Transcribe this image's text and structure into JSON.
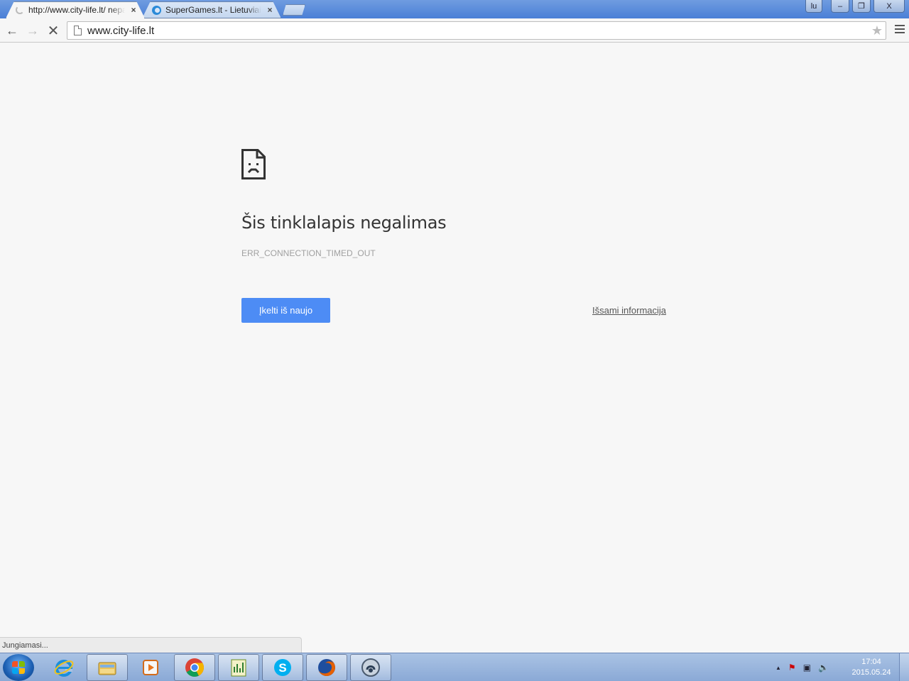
{
  "browser": {
    "tabs": [
      {
        "title": "http://www.city-life.lt/ nepasiekiamas",
        "icon": "loading-spinner-icon",
        "close": "×",
        "active": true
      },
      {
        "title": "SuperGames.lt - Lietuviai žaidimai",
        "icon": "supergames-favicon-icon",
        "close": "×",
        "active": false
      }
    ],
    "window_buttons": {
      "user": "lu",
      "minimize": "–",
      "maximize": "❐",
      "close": "X"
    },
    "toolbar": {
      "back": "←",
      "forward": "→",
      "stop": "✕",
      "url": "www.city-life.lt",
      "star": "★"
    }
  },
  "error_page": {
    "title": "Šis tinklalapis negalimas",
    "code": "ERR_CONNECTION_TIMED_OUT",
    "reload_label": "Įkelti iš naujo",
    "details_label": "Išsami informacija"
  },
  "status_bar": {
    "text": "Jungiamasi..."
  },
  "taskbar": {
    "apps": [
      "internet-explorer",
      "windows-explorer",
      "media-player",
      "google-chrome",
      "spreadsheet-editor",
      "skype",
      "firefox",
      "teamspeak"
    ],
    "tray": {
      "up_arrow": "▲",
      "flag": "⚑",
      "network": "▣",
      "volume": "🔈"
    },
    "clock": {
      "time": "17:04",
      "date": "2015.05.24"
    }
  },
  "colors": {
    "accent_button": "#4d8cf5",
    "page_background": "#f7f7f7",
    "taskbar": "#8aa9d6"
  }
}
